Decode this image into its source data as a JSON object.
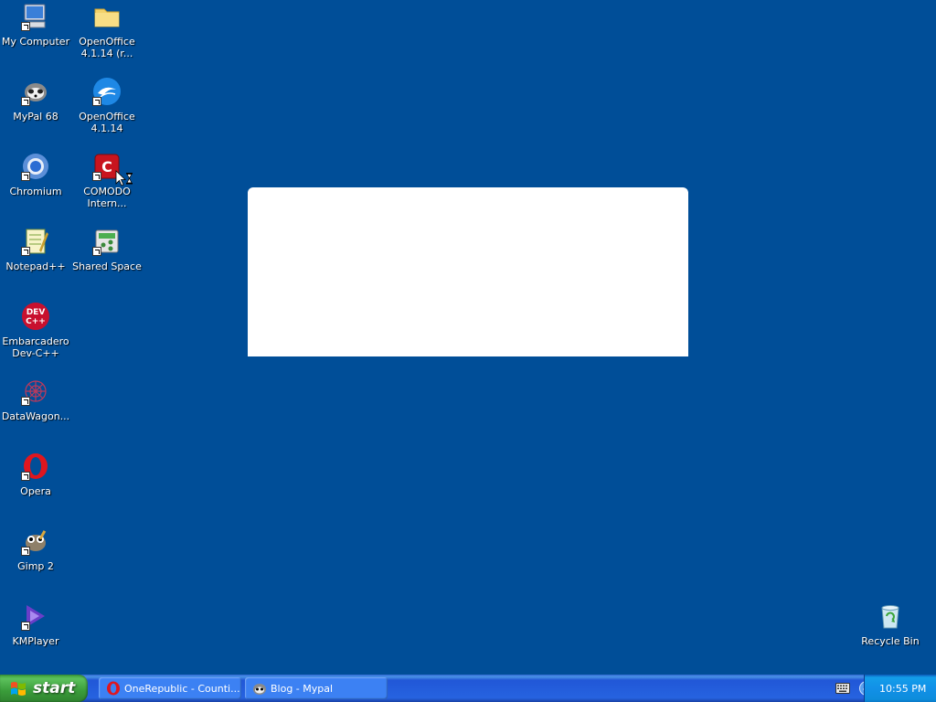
{
  "desktop": {
    "background": "#004e98",
    "icons": [
      {
        "label": "My Computer",
        "icon": "computer-icon"
      },
      {
        "label": "OpenOffice\n4.1.14 (r...",
        "icon": "folder-icon"
      },
      {
        "label": "MyPal 68",
        "icon": "mypal-icon"
      },
      {
        "label": "OpenOffice\n4.1.14",
        "icon": "openoffice-icon"
      },
      {
        "label": "Chromium",
        "icon": "chromium-icon"
      },
      {
        "label": "COMODO\nIntern...",
        "icon": "comodo-icon"
      },
      {
        "label": "Notepad++",
        "icon": "notepadpp-icon"
      },
      {
        "label": "Shared Space",
        "icon": "shared-space-icon"
      },
      {
        "label": "Embarcadero\nDev-C++",
        "icon": "devcpp-icon"
      },
      {
        "label": "DataWagon...",
        "icon": "datawagon-icon"
      },
      {
        "label": "Opera",
        "icon": "opera-icon"
      },
      {
        "label": "Gimp 2",
        "icon": "gimp-icon"
      },
      {
        "label": "KMPlayer",
        "icon": "kmplayer-icon"
      },
      {
        "label": "Recycle Bin",
        "icon": "recycle-bin-icon"
      }
    ]
  },
  "taskbar": {
    "start_label": "start",
    "tasks": [
      {
        "label": "OneRepublic - Counti...",
        "icon": "opera-icon"
      },
      {
        "label": "Blog - Mypal",
        "icon": "mypal-icon"
      }
    ],
    "clock": "10:55 PM"
  }
}
